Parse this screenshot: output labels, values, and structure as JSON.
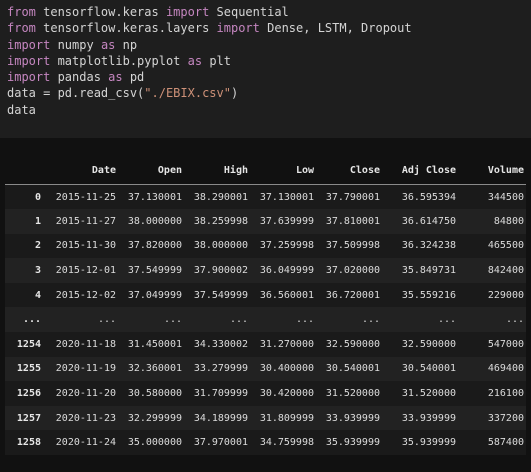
{
  "code": {
    "lines": [
      [
        {
          "t": "from",
          "c": "kw"
        },
        {
          "t": " tensorflow.keras ",
          "c": "plain"
        },
        {
          "t": "import",
          "c": "kw"
        },
        {
          "t": " Sequential",
          "c": "plain"
        }
      ],
      [
        {
          "t": "from",
          "c": "kw"
        },
        {
          "t": " tensorflow.keras.layers ",
          "c": "plain"
        },
        {
          "t": "import",
          "c": "kw"
        },
        {
          "t": " Dense, LSTM, Dropout",
          "c": "plain"
        }
      ],
      [
        {
          "t": "import",
          "c": "kw"
        },
        {
          "t": " numpy ",
          "c": "plain"
        },
        {
          "t": "as",
          "c": "kw"
        },
        {
          "t": " np",
          "c": "plain"
        }
      ],
      [
        {
          "t": "import",
          "c": "kw"
        },
        {
          "t": " matplotlib.pyplot ",
          "c": "plain"
        },
        {
          "t": "as",
          "c": "kw"
        },
        {
          "t": " plt",
          "c": "plain"
        }
      ],
      [
        {
          "t": "import",
          "c": "kw"
        },
        {
          "t": " pandas ",
          "c": "plain"
        },
        {
          "t": "as",
          "c": "kw"
        },
        {
          "t": " pd",
          "c": "plain"
        }
      ],
      [
        {
          "t": "data = pd.read_csv(",
          "c": "plain"
        },
        {
          "t": "\"./EBIX.csv\"",
          "c": "str"
        },
        {
          "t": ")",
          "c": "plain"
        }
      ],
      [
        {
          "t": "data",
          "c": "plain"
        }
      ]
    ]
  },
  "dataframe": {
    "columns": [
      "",
      "Date",
      "Open",
      "High",
      "Low",
      "Close",
      "Adj Close",
      "Volume"
    ],
    "rows": [
      [
        "0",
        "2015-11-25",
        "37.130001",
        "38.290001",
        "37.130001",
        "37.790001",
        "36.595394",
        "344500"
      ],
      [
        "1",
        "2015-11-27",
        "38.000000",
        "38.259998",
        "37.639999",
        "37.810001",
        "36.614750",
        "84800"
      ],
      [
        "2",
        "2015-11-30",
        "37.820000",
        "38.000000",
        "37.259998",
        "37.509998",
        "36.324238",
        "465500"
      ],
      [
        "3",
        "2015-12-01",
        "37.549999",
        "37.900002",
        "36.049999",
        "37.020000",
        "35.849731",
        "842400"
      ],
      [
        "4",
        "2015-12-02",
        "37.049999",
        "37.549999",
        "36.560001",
        "36.720001",
        "35.559216",
        "229000"
      ],
      [
        "...",
        "...",
        "...",
        "...",
        "...",
        "...",
        "...",
        "..."
      ],
      [
        "1254",
        "2020-11-18",
        "31.450001",
        "34.330002",
        "31.270000",
        "32.590000",
        "32.590000",
        "547000"
      ],
      [
        "1255",
        "2020-11-19",
        "32.360001",
        "33.279999",
        "30.400000",
        "30.540001",
        "30.540001",
        "469400"
      ],
      [
        "1256",
        "2020-11-20",
        "30.580000",
        "31.709999",
        "30.420000",
        "31.520000",
        "31.520000",
        "216100"
      ],
      [
        "1257",
        "2020-11-23",
        "32.299999",
        "34.189999",
        "31.809999",
        "33.939999",
        "33.939999",
        "337200"
      ],
      [
        "1258",
        "2020-11-24",
        "35.000000",
        "37.970001",
        "34.759998",
        "35.939999",
        "35.939999",
        "587400"
      ]
    ]
  },
  "colors": {
    "keyword": "#c586c0",
    "string": "#ce9178",
    "code_background": "#1e1e1e",
    "output_background": "#111111"
  }
}
